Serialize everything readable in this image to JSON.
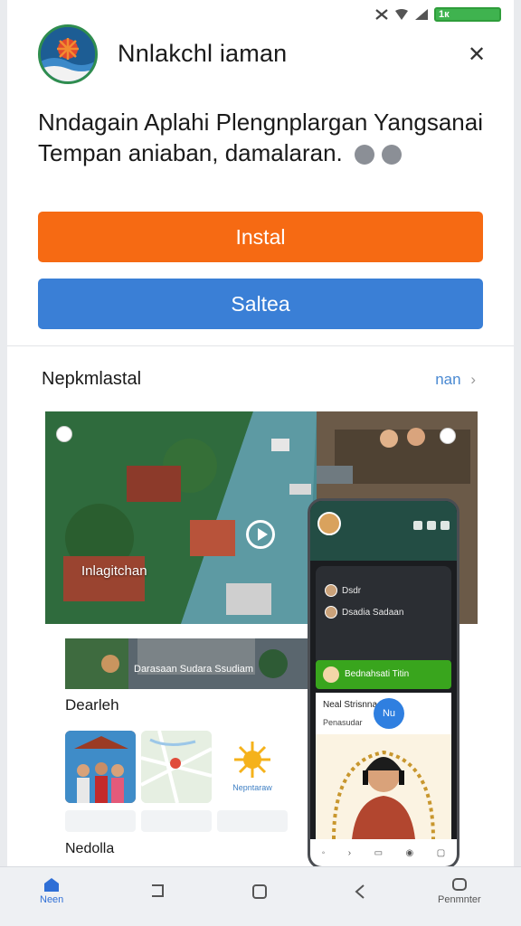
{
  "status_bar": {
    "battery_text": "1к",
    "icons": [
      "no-signal-icon",
      "wifi-icon",
      "signal-icon",
      "battery-icon"
    ]
  },
  "header": {
    "logo": "app-logo",
    "title": "Nnlakchl iaman",
    "close_icon": "close-icon"
  },
  "description": {
    "line1": "Nndagain  Aplahi Plengnplargan Yangsanai",
    "line2": "Tempan aniaban, damalaran.",
    "icons": [
      "emoji-icon",
      "emoji-icon"
    ]
  },
  "buttons": {
    "install_label": "Instal",
    "second_label": "Saltea",
    "install_color": "#f66a13",
    "second_color": "#3a7fd6"
  },
  "section": {
    "title": "Nepkmlastal",
    "more_label": "nan"
  },
  "gallery": {
    "hero_label": "Inlagitchan",
    "strip_label": "Darasaan Sudara Ssudiam",
    "label_a": "Dearleh",
    "tile_caption": "Nepntaraw",
    "label_b": "Nedolla"
  },
  "phone": {
    "row1": "Dsdr",
    "row2": "Dsadia Sadaan",
    "green_bar": "Bednahsati Titin",
    "card_title": "Neal Strisnna",
    "card_sub": "Penasudar",
    "fab_label": "Nu"
  },
  "bottom_nav": {
    "home_label": "Neen",
    "profile_label": "Penmnter"
  }
}
